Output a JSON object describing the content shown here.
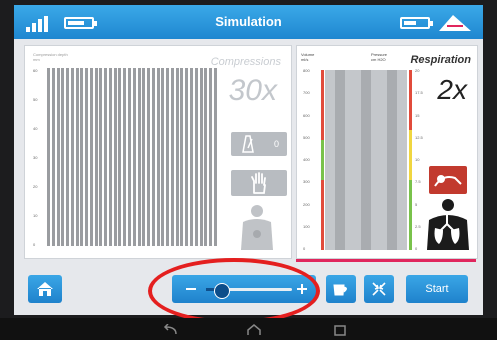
{
  "header": {
    "title": "Simulation"
  },
  "compressions": {
    "title": "Compressions",
    "rate": "30x",
    "depth_label": "Compression depth",
    "depth_unit": "mm",
    "axis": [
      "60",
      "50",
      "40",
      "30",
      "20",
      "10",
      "0"
    ],
    "metronome_value": "0",
    "bar_count": 36
  },
  "respiration": {
    "title": "Respiration",
    "rate": "2x",
    "volume_label": "Volume",
    "volume_unit": "ml/s",
    "pressure_label": "Pressure",
    "pressure_unit": "cm H2O",
    "volume_axis": [
      "800",
      "700",
      "600",
      "500",
      "400",
      "300",
      "200",
      "100",
      "0"
    ],
    "pressure_axis": [
      "20",
      "17.5",
      "15",
      "12.5",
      "10",
      "7.5",
      "5",
      "2.5",
      "0"
    ]
  },
  "slider": {
    "level": 0.18
  },
  "footer": {
    "start_label": "Start"
  },
  "colors": {
    "accent": "#2a94da",
    "alert": "#e0265d",
    "slider_knob": "#0c4d8a"
  }
}
